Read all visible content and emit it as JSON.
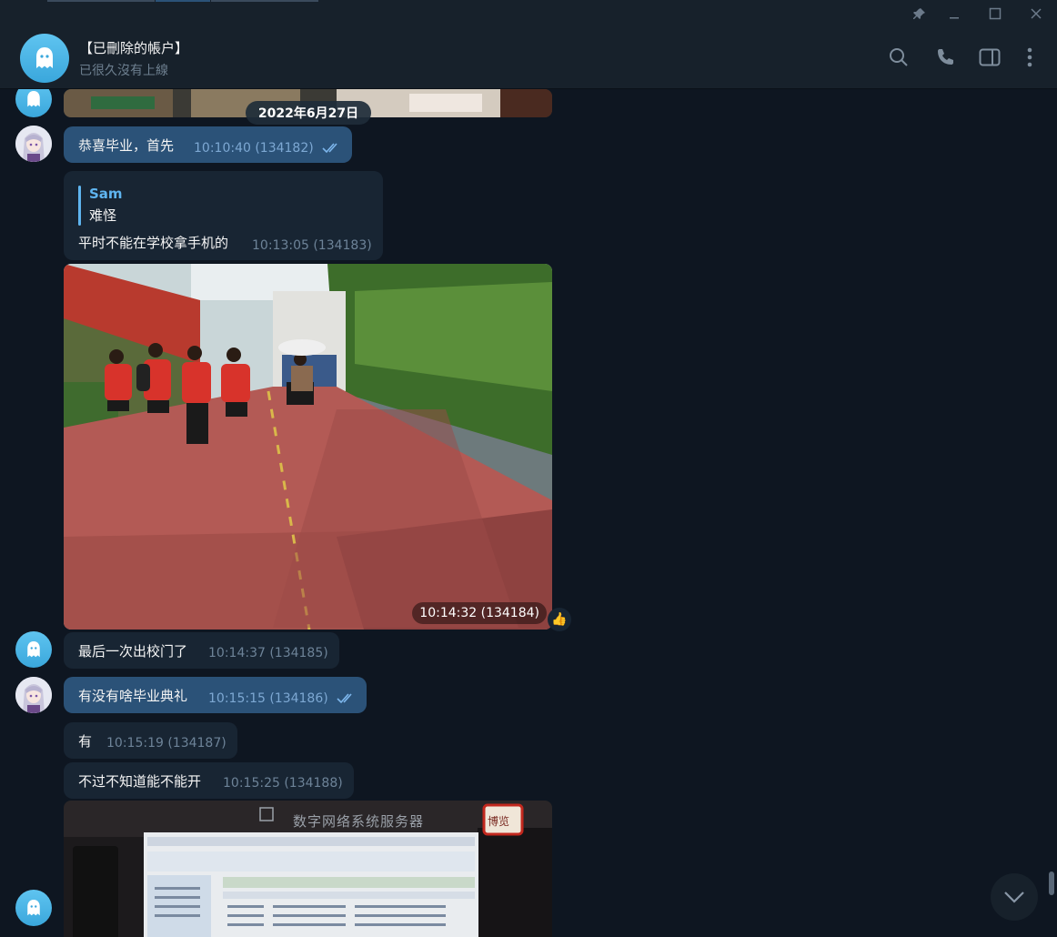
{
  "header": {
    "name": "【已刪除的帳户】",
    "status": "已很久沒有上線"
  },
  "date_separator": "2022年6月27日",
  "messages": [
    {
      "text": "恭喜毕业，首先",
      "time": "10:10:40 (134182)"
    },
    {
      "reply_author": "Sam",
      "reply_text": "难怪",
      "text": "平时不能在学校拿手机的",
      "time": "10:13:05 (134183)"
    },
    {
      "time": "10:14:32 (134184)",
      "reaction": "👍"
    },
    {
      "text": "最后一次出校门了",
      "time": "10:14:37 (134185)"
    },
    {
      "text": "有没有啥毕业典礼",
      "time": "10:15:15 (134186)"
    },
    {
      "text": "有",
      "time": "10:15:19 (134187)"
    },
    {
      "text": "不过不知道能不能开",
      "time": "10:15:25 (134188)"
    }
  ],
  "photo2": {
    "sign_text": "数字网络系统服务器",
    "stamp_text": "博览"
  },
  "colors": {
    "background": "#0e1621",
    "header": "#17212b",
    "incoming_bubble": "#182533",
    "outgoing_bubble": "#2b5278",
    "accent": "#5fb5f0"
  }
}
